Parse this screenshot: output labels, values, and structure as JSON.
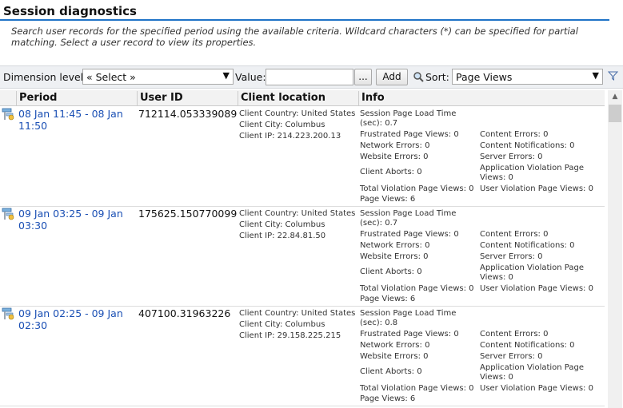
{
  "page": {
    "title": "Session diagnostics",
    "description": "Search user records for the specified period using the available criteria. Wildcard characters (*) can be specified for partial matching. Select a user record to view its properties."
  },
  "toolbar": {
    "dimension_label": "Dimension level:",
    "dimension_value": "« Select »",
    "value_label": "Value:",
    "value_input": "",
    "browse_label": "...",
    "add_label": "Add",
    "sort_label": "Sort:",
    "sort_value": "Page Views"
  },
  "columns": {
    "period": "Period",
    "user_id": "User ID",
    "client_location": "Client location",
    "info": "Info"
  },
  "rows": [
    {
      "period": "08 Jan 11:45 - 08 Jan 11:50",
      "user_id": "712114.053339089",
      "country": "Client Country: United States",
      "city": "Client City: Columbus",
      "ip": "Client IP: 214.223.200.13",
      "load_time_a": "Session Page Load Time",
      "load_time_b": "(sec): 0.7",
      "frustrated": "Frustrated Page Views: 0",
      "network": "Network Errors: 0",
      "website": "Website Errors: 0",
      "aborts": "Client Aborts: 0",
      "total_violation": "Total Violation Page Views: 0",
      "page_views": "Page Views: 6",
      "content_errors": "Content Errors: 0",
      "content_notifications": "Content Notifications: 0",
      "server_errors": "Server Errors: 0",
      "app_violation_a": "Application Violation Page",
      "app_violation_b": "Views: 0",
      "user_violation": "User Violation Page Views: 0"
    },
    {
      "period": "09 Jan 03:25 - 09 Jan 03:30",
      "user_id": "175625.150770099",
      "country": "Client Country: United States",
      "city": "Client City: Columbus",
      "ip": "Client IP: 22.84.81.50",
      "load_time_a": "Session Page Load Time",
      "load_time_b": "(sec): 0.7",
      "frustrated": "Frustrated Page Views: 0",
      "network": "Network Errors: 0",
      "website": "Website Errors: 0",
      "aborts": "Client Aborts: 0",
      "total_violation": "Total Violation Page Views: 0",
      "page_views": "Page Views: 6",
      "content_errors": "Content Errors: 0",
      "content_notifications": "Content Notifications: 0",
      "server_errors": "Server Errors: 0",
      "app_violation_a": "Application Violation Page",
      "app_violation_b": "Views: 0",
      "user_violation": "User Violation Page Views: 0"
    },
    {
      "period": "09 Jan 02:25 - 09 Jan 02:30",
      "user_id": "407100.31963226",
      "country": "Client Country: United States",
      "city": "Client City: Columbus",
      "ip": "Client IP: 29.158.225.215",
      "load_time_a": "Session Page Load Time",
      "load_time_b": "(sec): 0.8",
      "frustrated": "Frustrated Page Views: 0",
      "network": "Network Errors: 0",
      "website": "Website Errors: 0",
      "aborts": "Client Aborts: 0",
      "total_violation": "Total Violation Page Views: 0",
      "page_views": "Page Views: 6",
      "content_errors": "Content Errors: 0",
      "content_notifications": "Content Notifications: 0",
      "server_errors": "Server Errors: 0",
      "app_violation_a": "Application Violation Page",
      "app_violation_b": "Views: 0",
      "user_violation": "User Violation Page Views: 0"
    }
  ],
  "colors": {
    "accent": "#1f73c7",
    "link": "#1a4fb4",
    "toolbar_bg": "#eef0f3"
  },
  "icons": {
    "row": "user-record-icon",
    "sort": "magnifier-sort-icon",
    "filter": "filter-icon"
  }
}
